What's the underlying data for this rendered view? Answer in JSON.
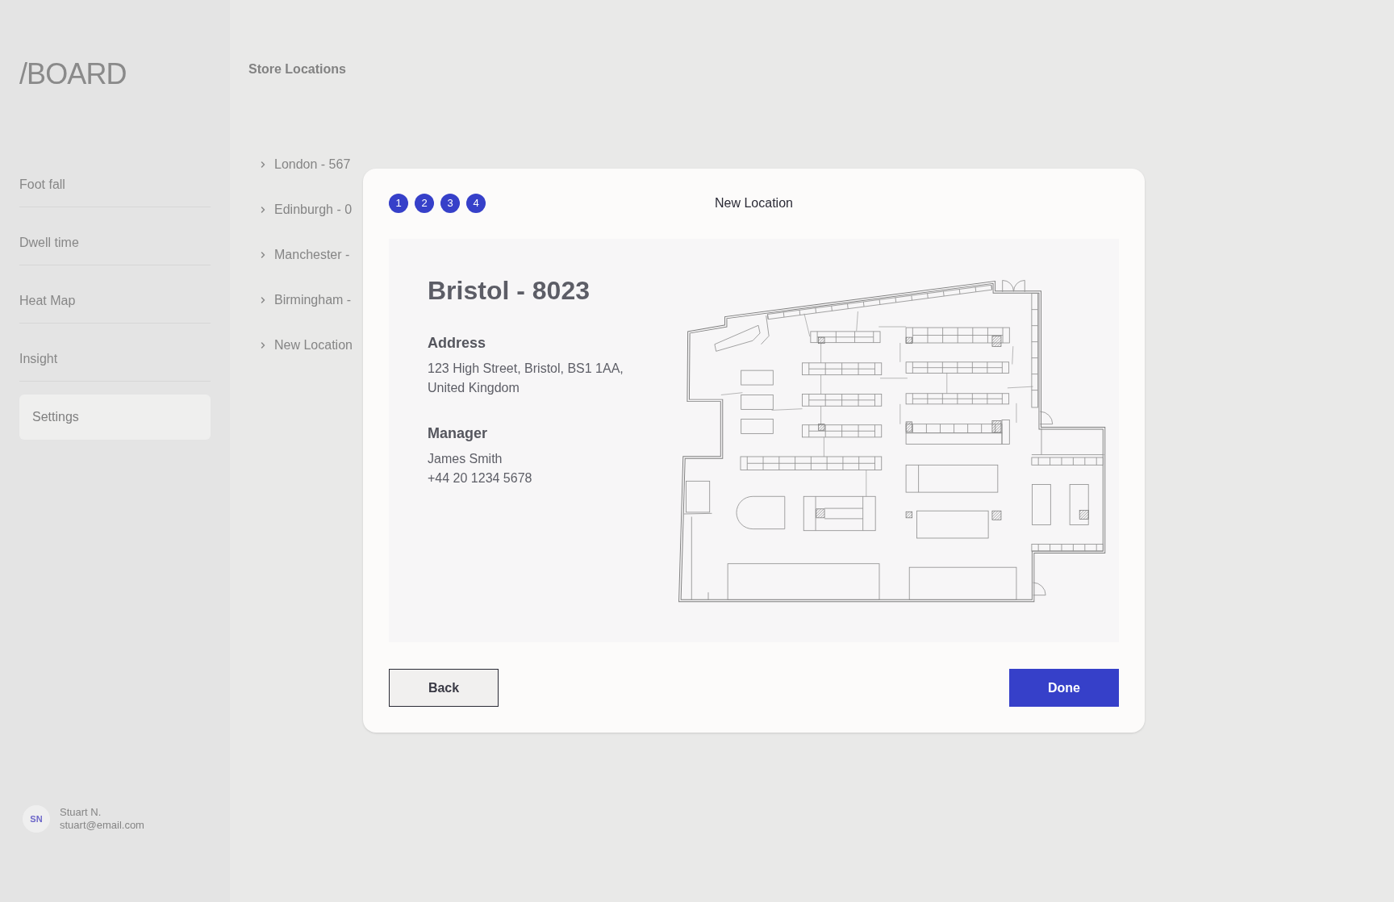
{
  "sidebar": {
    "logo": "**/**BOARD",
    "items": [
      {
        "label": "Foot fall",
        "selected": false
      },
      {
        "label": "Dwell time",
        "selected": false
      },
      {
        "label": "Heat Map",
        "selected": false
      },
      {
        "label": "Insight",
        "selected": false
      },
      {
        "label": "Settings",
        "selected": true
      }
    ],
    "user": {
      "initials": "SN",
      "name": "Stuart N.",
      "email": "stuart@email.com"
    }
  },
  "main": {
    "title": "Store Locations",
    "locations": [
      {
        "label": "London - 567"
      },
      {
        "label": "Edinburgh - 0"
      },
      {
        "label": "Manchester -"
      },
      {
        "label": "Birmingham -"
      },
      {
        "label": "New Location"
      }
    ]
  },
  "dialog": {
    "steps": [
      {
        "label": "1"
      },
      {
        "label": "2"
      },
      {
        "label": "3"
      },
      {
        "label": "4"
      }
    ],
    "title": "New Location",
    "location": {
      "name": "Bristol - 8023",
      "address": {
        "heading": "Address",
        "text": "123 High Street, Bristol, BS1 1AA, United Kingdom"
      },
      "manager": {
        "heading": "Manager",
        "name": "James Smith",
        "phone": "+44 20 1234 5678"
      }
    },
    "buttons": [
      {
        "label": "Back",
        "kind": "secondary"
      },
      {
        "label": "Done",
        "kind": "primary"
      }
    ]
  }
}
